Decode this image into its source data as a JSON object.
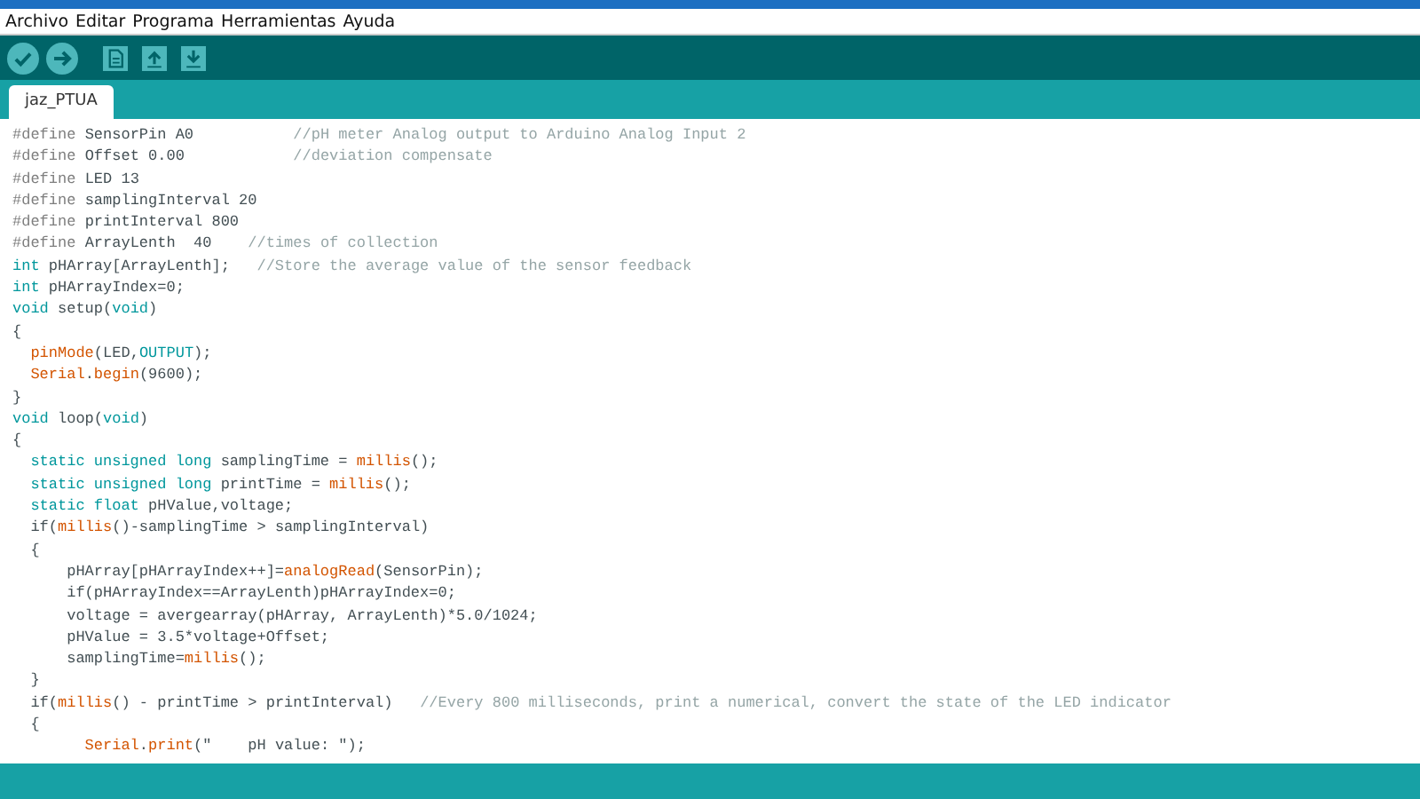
{
  "menu": [
    "Archivo",
    "Editar",
    "Programa",
    "Herramientas",
    "Ayuda"
  ],
  "toolbar": [
    {
      "kind": "verify"
    },
    {
      "kind": "upload"
    },
    {
      "kind": "new"
    },
    {
      "kind": "open"
    },
    {
      "kind": "save"
    }
  ],
  "tabs": [
    {
      "label": "jaz_PTUA",
      "selected": true
    }
  ],
  "code": [
    [
      {
        "text": "#define",
        "kind": "directive"
      },
      {
        "text": " SensorPin A0           ",
        "kind": "plain"
      },
      {
        "text": "//pH meter Analog output to Arduino Analog Input 2",
        "kind": "comment"
      }
    ],
    [
      {
        "text": "#define",
        "kind": "directive"
      },
      {
        "text": " Offset 0.00            ",
        "kind": "plain"
      },
      {
        "text": "//deviation compensate",
        "kind": "comment"
      }
    ],
    [
      {
        "text": "#define",
        "kind": "directive"
      },
      {
        "text": " LED 13",
        "kind": "plain"
      }
    ],
    [
      {
        "text": "#define",
        "kind": "directive"
      },
      {
        "text": " samplingInterval 20",
        "kind": "plain"
      }
    ],
    [
      {
        "text": "#define",
        "kind": "directive"
      },
      {
        "text": " printInterval 800",
        "kind": "plain"
      }
    ],
    [
      {
        "text": "#define",
        "kind": "directive"
      },
      {
        "text": " ArrayLenth  40    ",
        "kind": "plain"
      },
      {
        "text": "//times of collection",
        "kind": "comment"
      }
    ],
    [
      {
        "text": "int",
        "kind": "type"
      },
      {
        "text": " pHArray[ArrayLenth];   ",
        "kind": "plain"
      },
      {
        "text": "//Store the average value of the sensor feedback",
        "kind": "comment"
      }
    ],
    [
      {
        "text": "int",
        "kind": "type"
      },
      {
        "text": " pHArrayIndex=0;",
        "kind": "plain"
      }
    ],
    [
      {
        "text": "void",
        "kind": "type"
      },
      {
        "text": " setup(",
        "kind": "plain"
      },
      {
        "text": "void",
        "kind": "type"
      },
      {
        "text": ")",
        "kind": "plain"
      }
    ],
    [
      {
        "text": "{",
        "kind": "plain"
      }
    ],
    [
      {
        "text": "  pinMode",
        "kind": "func"
      },
      {
        "text": "(LED,",
        "kind": "plain"
      },
      {
        "text": "OUTPUT",
        "kind": "const"
      },
      {
        "text": ");",
        "kind": "plain"
      }
    ],
    [
      {
        "text": "  Serial",
        "kind": "func"
      },
      {
        "text": ".",
        "kind": "plain"
      },
      {
        "text": "begin",
        "kind": "func"
      },
      {
        "text": "(9600);",
        "kind": "plain"
      }
    ],
    [
      {
        "text": "}",
        "kind": "plain"
      }
    ],
    [
      {
        "text": "void",
        "kind": "type"
      },
      {
        "text": " loop(",
        "kind": "plain"
      },
      {
        "text": "void",
        "kind": "type"
      },
      {
        "text": ")",
        "kind": "plain"
      }
    ],
    [
      {
        "text": "{",
        "kind": "plain"
      }
    ],
    [
      {
        "text": "  static unsigned long",
        "kind": "type"
      },
      {
        "text": " samplingTime = ",
        "kind": "plain"
      },
      {
        "text": "millis",
        "kind": "func"
      },
      {
        "text": "();",
        "kind": "plain"
      }
    ],
    [
      {
        "text": "  static unsigned long",
        "kind": "type"
      },
      {
        "text": " printTime = ",
        "kind": "plain"
      },
      {
        "text": "millis",
        "kind": "func"
      },
      {
        "text": "();",
        "kind": "plain"
      }
    ],
    [
      {
        "text": "  static float",
        "kind": "type"
      },
      {
        "text": " pHValue,voltage;",
        "kind": "plain"
      }
    ],
    [
      {
        "text": "  if(",
        "kind": "plain"
      },
      {
        "text": "millis",
        "kind": "func"
      },
      {
        "text": "()-samplingTime > samplingInterval)",
        "kind": "plain"
      }
    ],
    [
      {
        "text": "  {",
        "kind": "plain"
      }
    ],
    [
      {
        "text": "      pHArray[pHArrayIndex++]=",
        "kind": "plain"
      },
      {
        "text": "analogRead",
        "kind": "func"
      },
      {
        "text": "(SensorPin);",
        "kind": "plain"
      }
    ],
    [
      {
        "text": "      if(pHArrayIndex==ArrayLenth)pHArrayIndex=0;",
        "kind": "plain"
      }
    ],
    [
      {
        "text": "      voltage = avergearray(pHArray, ArrayLenth)*5.0/1024;",
        "kind": "plain"
      }
    ],
    [
      {
        "text": "      pHValue = 3.5*voltage+Offset;",
        "kind": "plain"
      }
    ],
    [
      {
        "text": "      samplingTime=",
        "kind": "plain"
      },
      {
        "text": "millis",
        "kind": "func"
      },
      {
        "text": "();",
        "kind": "plain"
      }
    ],
    [
      {
        "text": "  }",
        "kind": "plain"
      }
    ],
    [
      {
        "text": "  if(",
        "kind": "plain"
      },
      {
        "text": "millis",
        "kind": "func"
      },
      {
        "text": "() - printTime > printInterval)   ",
        "kind": "plain"
      },
      {
        "text": "//Every 800 milliseconds, print a numerical, convert the state of the LED indicator",
        "kind": "comment"
      }
    ],
    [
      {
        "text": "  {",
        "kind": "plain"
      }
    ],
    [
      {
        "text": "        Serial",
        "kind": "func"
      },
      {
        "text": ".",
        "kind": "plain"
      },
      {
        "text": "print",
        "kind": "func"
      },
      {
        "text": "(\"    pH value: \");",
        "kind": "plain"
      }
    ]
  ]
}
